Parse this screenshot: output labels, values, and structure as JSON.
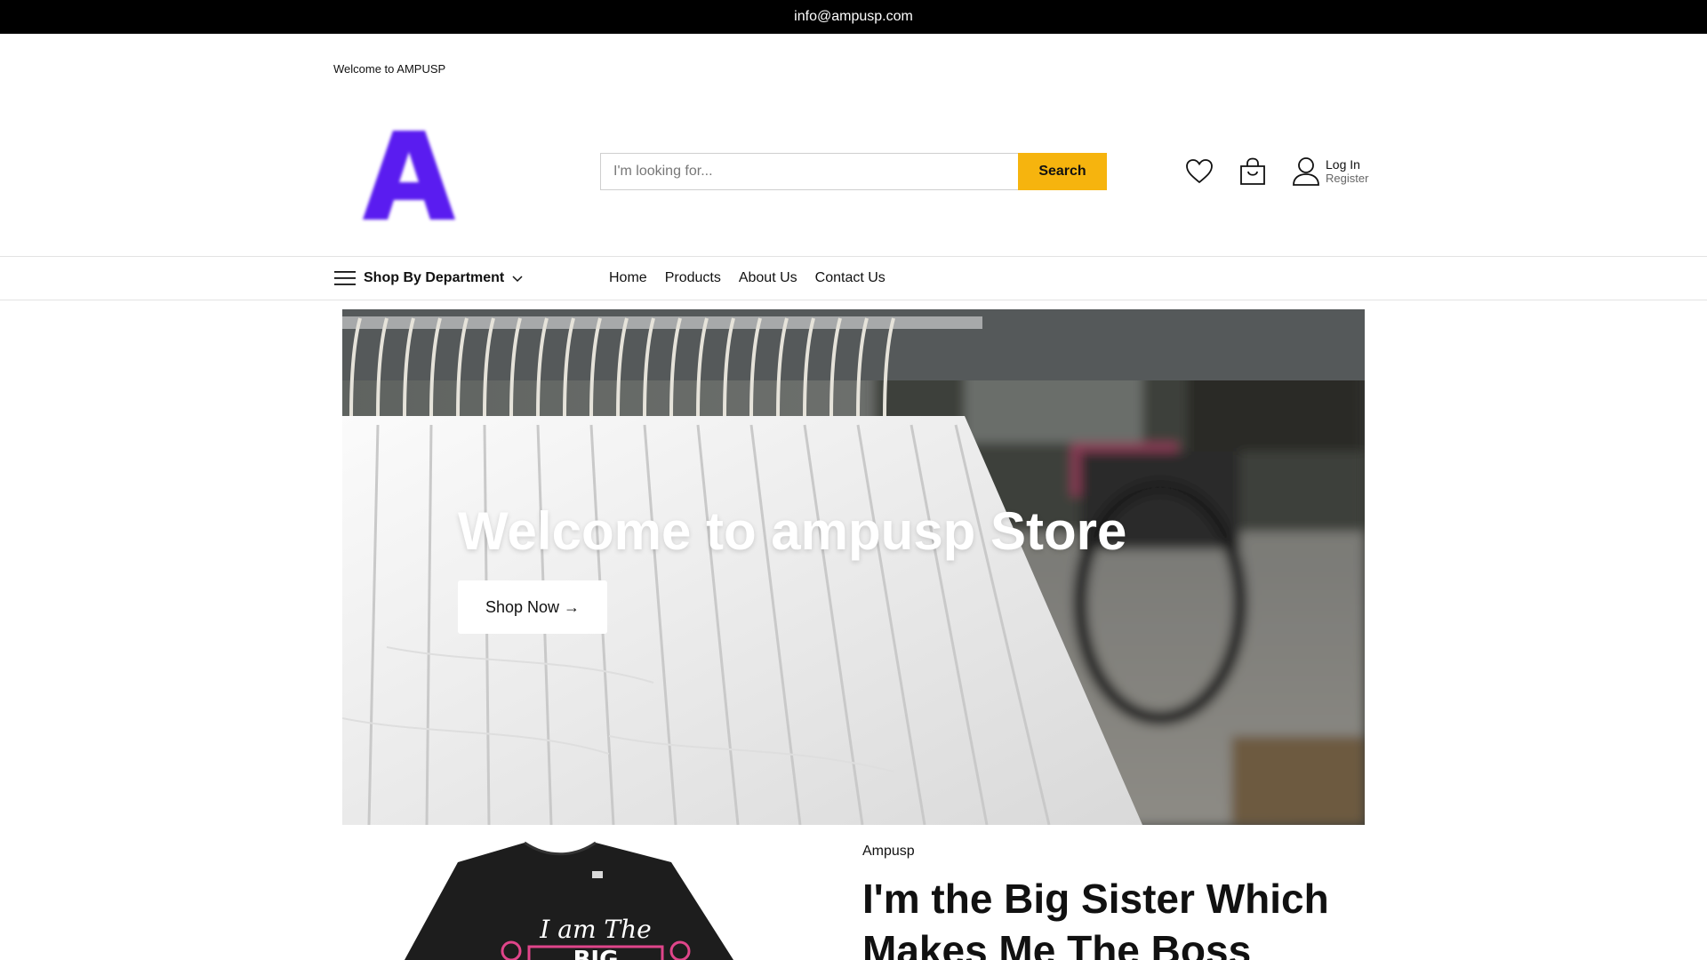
{
  "topbar": {
    "email": "info@ampusp.com"
  },
  "header": {
    "welcome": "Welcome to AMPUSP",
    "logo_letter": "A",
    "search": {
      "placeholder": "I'm looking for...",
      "button_label": "Search"
    },
    "account": {
      "login_label": "Log In",
      "register_label": "Register"
    },
    "icons": [
      "heart-icon",
      "shopping-bag-icon",
      "user-icon"
    ]
  },
  "nav": {
    "department_label": "Shop By Department",
    "items": [
      "Home",
      "Products",
      "About Us",
      "Contact Us"
    ]
  },
  "hero": {
    "title": "Welcome to ampusp Store",
    "button_label": "Shop Now →"
  },
  "product": {
    "brand": "Ampusp",
    "title": "I'm the Big Sister Which Makes Me The Boss",
    "image_text_top": "I am The",
    "image_text_mid": "BIG"
  },
  "colors": {
    "accent": "#f6b40e",
    "logo": "#5a1ef0",
    "topbar": "#000000"
  }
}
